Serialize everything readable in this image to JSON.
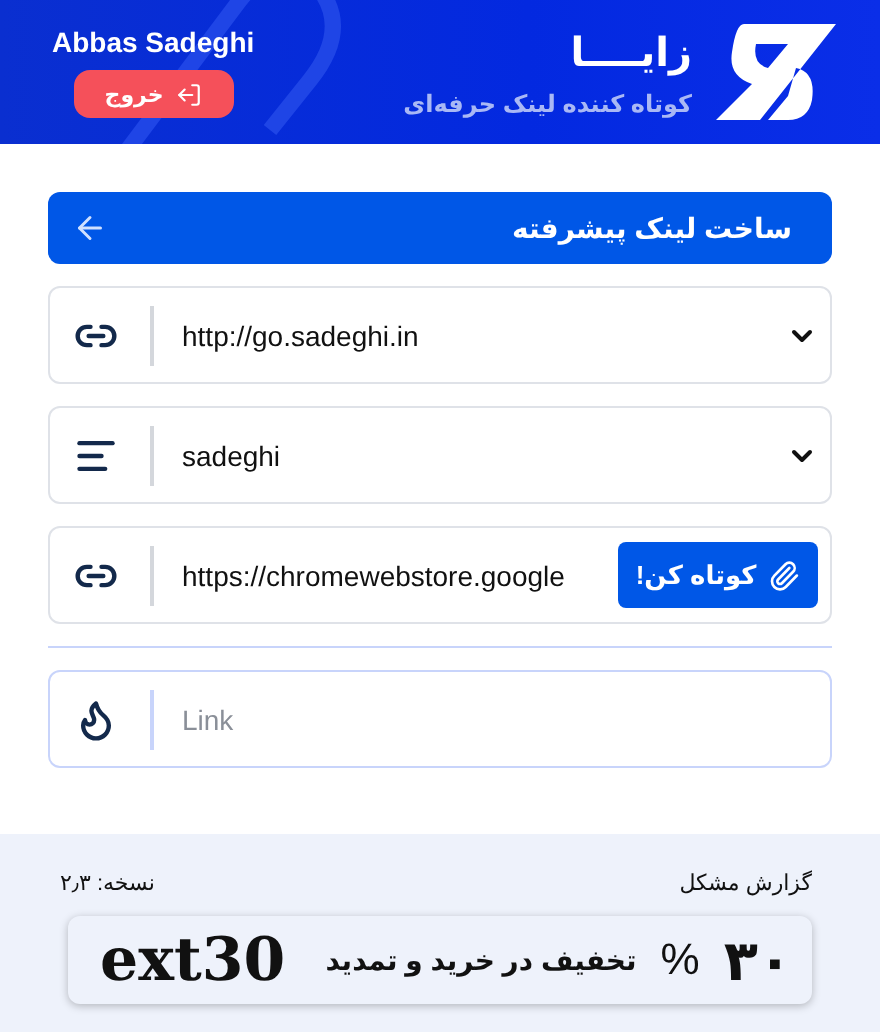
{
  "header": {
    "brand": "زایــــا",
    "tagline": "کوتاه کننده لینک حرفه‌ای",
    "user_name": "Abbas Sadeghi",
    "logout": "خروج"
  },
  "title_bar": {
    "title": "ساخت لینک پیشرفته"
  },
  "fields": [
    {
      "kind": "domain",
      "value": "http://go.sadeghi.in"
    },
    {
      "kind": "alias",
      "value": "sadeghi"
    },
    {
      "kind": "url",
      "value": "https://chromewebstore.google",
      "button": "کوتاه کن!"
    },
    {
      "kind": "result",
      "placeholder": "Link"
    }
  ],
  "footer": {
    "report": "گزارش مشکل",
    "version": "نسخه: ۲٫۳",
    "promo": {
      "amount": "۳۰",
      "percent": "%",
      "text": "تخفیف در خرید و تمدید",
      "code": "ext30"
    }
  }
}
